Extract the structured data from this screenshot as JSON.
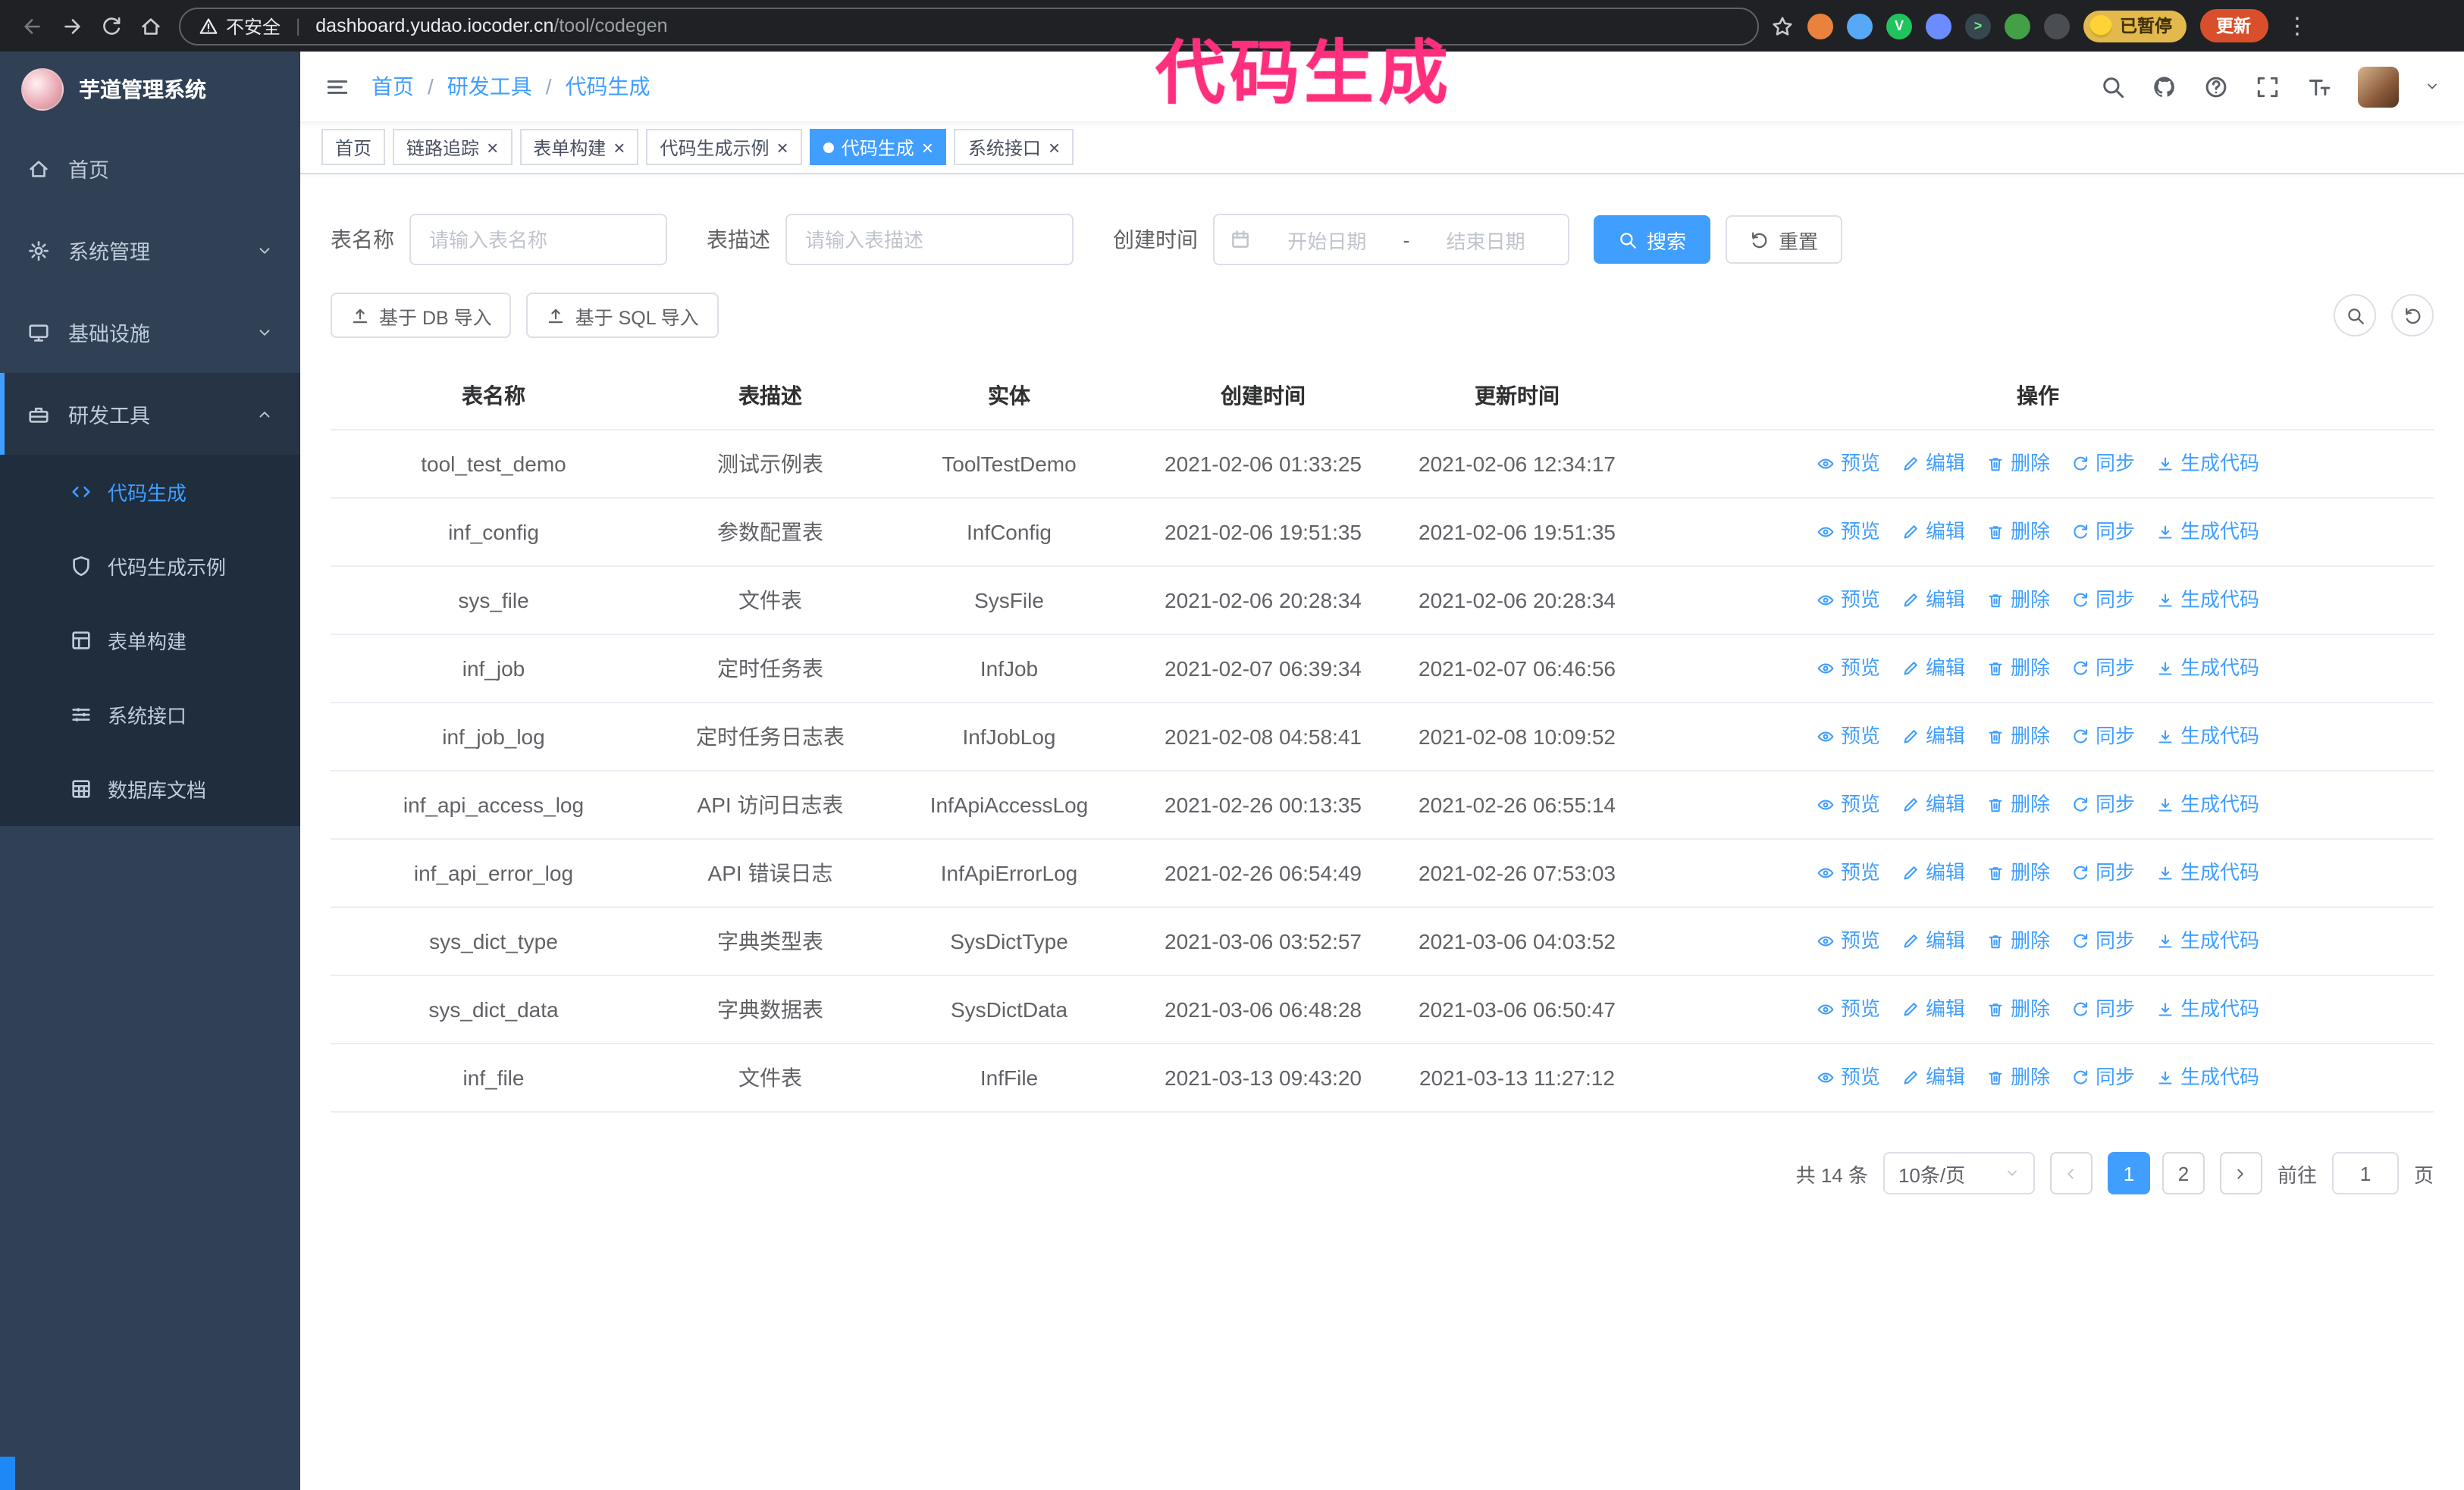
{
  "browser": {
    "security_label": "不安全",
    "url_domain": "dashboard.yudao.iocoder.cn",
    "url_path": "/tool/codegen",
    "paused_badge": "已暂停",
    "update_button": "更新"
  },
  "annotation": {
    "text": "代码生成",
    "color": "#ff2f7e"
  },
  "sidebar": {
    "logo_title": "芋道管理系统",
    "items": [
      {
        "name": "home",
        "label": "首页",
        "icon": "home-icon",
        "expandable": false,
        "expanded": false
      },
      {
        "name": "system",
        "label": "系统管理",
        "icon": "gear-icon",
        "expandable": true,
        "expanded": false
      },
      {
        "name": "infra",
        "label": "基础设施",
        "icon": "monitor-icon",
        "expandable": true,
        "expanded": false
      },
      {
        "name": "devtool",
        "label": "研发工具",
        "icon": "toolbox-icon",
        "expandable": true,
        "expanded": true
      }
    ],
    "submenu": [
      {
        "name": "code-generation",
        "label": "代码生成",
        "icon": "code-icon",
        "active": true
      },
      {
        "name": "codegen-example",
        "label": "代码生成示例",
        "icon": "shield-icon",
        "active": false
      },
      {
        "name": "form-builder",
        "label": "表单构建",
        "icon": "form-icon",
        "active": false
      },
      {
        "name": "system-api",
        "label": "系统接口",
        "icon": "sliders-icon",
        "active": false
      },
      {
        "name": "db-doc",
        "label": "数据库文档",
        "icon": "database-icon",
        "active": false
      }
    ]
  },
  "header": {
    "breadcrumb": [
      {
        "label": "首页"
      },
      {
        "label": "研发工具"
      },
      {
        "label": "代码生成"
      }
    ]
  },
  "tabs": [
    {
      "name": "home",
      "label": "首页",
      "closable": false,
      "active": false
    },
    {
      "name": "trace",
      "label": "链路追踪",
      "closable": true,
      "active": false
    },
    {
      "name": "form-builder",
      "label": "表单构建",
      "closable": true,
      "active": false
    },
    {
      "name": "codegen-example",
      "label": "代码生成示例",
      "closable": true,
      "active": false
    },
    {
      "name": "codegen",
      "label": "代码生成",
      "closable": true,
      "active": true
    },
    {
      "name": "system-api",
      "label": "系统接口",
      "closable": true,
      "active": false
    }
  ],
  "filters": {
    "table_name_label": "表名称",
    "table_name_placeholder": "请输入表名称",
    "table_desc_label": "表描述",
    "table_desc_placeholder": "请输入表描述",
    "create_time_label": "创建时间",
    "date_start_placeholder": "开始日期",
    "date_separator": "-",
    "date_end_placeholder": "结束日期",
    "search_button": "搜索",
    "reset_button": "重置"
  },
  "toolbar": {
    "import_db_label": "基于 DB 导入",
    "import_sql_label": "基于 SQL 导入"
  },
  "table": {
    "columns": [
      "表名称",
      "表描述",
      "实体",
      "创建时间",
      "更新时间",
      "操作"
    ],
    "actions": [
      "预览",
      "编辑",
      "删除",
      "同步",
      "生成代码"
    ],
    "rows": [
      {
        "name": "tool_test_demo",
        "desc": "测试示例表",
        "entity": "ToolTestDemo",
        "created": "2021-02-06 01:33:25",
        "updated": "2021-02-06 12:34:17"
      },
      {
        "name": "inf_config",
        "desc": "参数配置表",
        "entity": "InfConfig",
        "created": "2021-02-06 19:51:35",
        "updated": "2021-02-06 19:51:35"
      },
      {
        "name": "sys_file",
        "desc": "文件表",
        "entity": "SysFile",
        "created": "2021-02-06 20:28:34",
        "updated": "2021-02-06 20:28:34"
      },
      {
        "name": "inf_job",
        "desc": "定时任务表",
        "entity": "InfJob",
        "created": "2021-02-07 06:39:34",
        "updated": "2021-02-07 06:46:56"
      },
      {
        "name": "inf_job_log",
        "desc": "定时任务日志表",
        "entity": "InfJobLog",
        "created": "2021-02-08 04:58:41",
        "updated": "2021-02-08 10:09:52"
      },
      {
        "name": "inf_api_access_log",
        "desc": "API 访问日志表",
        "entity": "InfApiAccessLog",
        "created": "2021-02-26 00:13:35",
        "updated": "2021-02-26 06:55:14"
      },
      {
        "name": "inf_api_error_log",
        "desc": "API 错误日志",
        "entity": "InfApiErrorLog",
        "created": "2021-02-26 06:54:49",
        "updated": "2021-02-26 07:53:03"
      },
      {
        "name": "sys_dict_type",
        "desc": "字典类型表",
        "entity": "SysDictType",
        "created": "2021-03-06 03:52:57",
        "updated": "2021-03-06 04:03:52"
      },
      {
        "name": "sys_dict_data",
        "desc": "字典数据表",
        "entity": "SysDictData",
        "created": "2021-03-06 06:48:28",
        "updated": "2021-03-06 06:50:47"
      },
      {
        "name": "inf_file",
        "desc": "文件表",
        "entity": "InfFile",
        "created": "2021-03-13 09:43:20",
        "updated": "2021-03-13 11:27:12"
      }
    ]
  },
  "pagination": {
    "total_label": "共 14 条",
    "page_size_label": "10条/页",
    "pages": [
      "1",
      "2"
    ],
    "active_page": "1",
    "goto_label": "前往",
    "goto_value": "1",
    "page_unit": "页"
  },
  "colors": {
    "accent": "#409eff",
    "sidebar_bg": "#304156",
    "submenu_bg": "#1f2d3d",
    "annotation": "#ff2f7e"
  }
}
